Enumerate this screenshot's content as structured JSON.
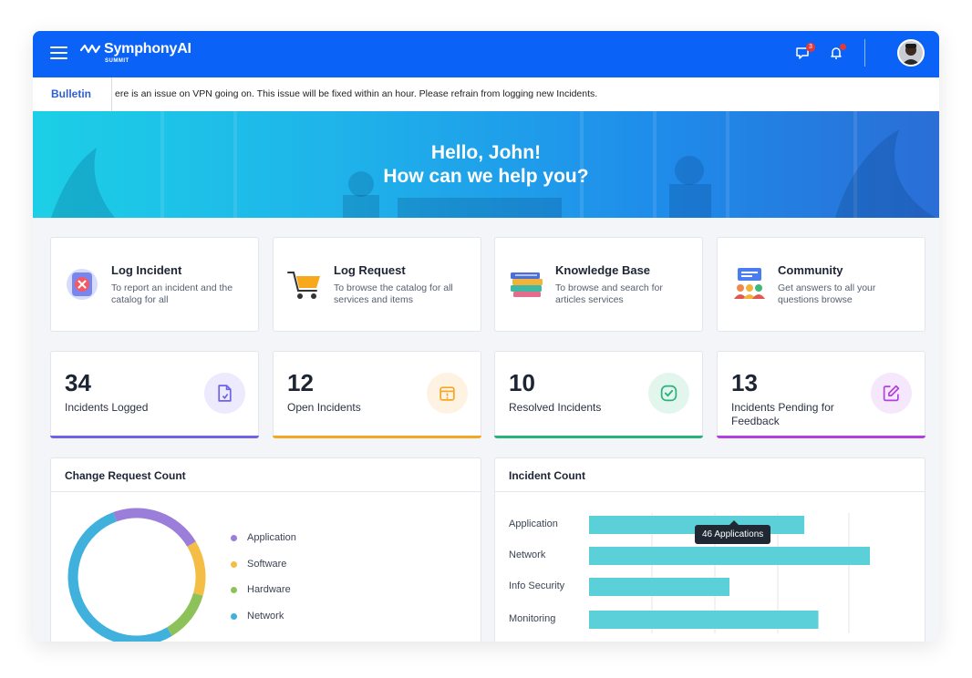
{
  "header": {
    "brand": "SymphonyAI",
    "brand_sub": "SUMMIT",
    "chat_badge": "3",
    "icons": [
      "menu-icon",
      "chat-icon",
      "bell-icon"
    ],
    "accent": "#0a62f7"
  },
  "bulletin": {
    "label": "Bulletin",
    "text": "ere is an issue on VPN going on. This issue will be fixed within an hour. Please refrain from logging new Incidents."
  },
  "hero": {
    "line1": "Hello, John!",
    "line2": "How can we help you?"
  },
  "actions": [
    {
      "title": "Log Incident",
      "desc": "To report an incident and the catalog for all",
      "icon": "incident-icon"
    },
    {
      "title": "Log Request",
      "desc": "To browse the catalog for all services and items",
      "icon": "cart-icon"
    },
    {
      "title": "Knowledge Base",
      "desc": "To browse and search for articles services",
      "icon": "books-icon"
    },
    {
      "title": "Community",
      "desc": "Get answers to all your questions browse",
      "icon": "community-icon"
    }
  ],
  "stats": [
    {
      "value": "34",
      "label": "Incidents Logged",
      "color": "#6c63e6",
      "icon": "document-icon"
    },
    {
      "value": "12",
      "label": "Open Incidents",
      "color": "#f5a623",
      "icon": "open-box-icon"
    },
    {
      "value": "10",
      "label": "Resolved Incidents",
      "color": "#27b37a",
      "icon": "check-icon"
    },
    {
      "value": "13",
      "label": "Incidents Pending for Feedback",
      "color": "#b23fe0",
      "icon": "edit-icon"
    }
  ],
  "change_request": {
    "title": "Change Request Count",
    "legend": [
      {
        "label": "Application",
        "color": "#9b7ed9"
      },
      {
        "label": "Software",
        "color": "#f4bd45"
      },
      {
        "label": "Hardware",
        "color": "#8dc25a"
      },
      {
        "label": "Network",
        "color": "#3fb1dc"
      }
    ]
  },
  "incident_count": {
    "title": "Incident Count",
    "tooltip": "46 Applications",
    "bar_color": "#5bd0d8"
  },
  "chart_data": [
    {
      "type": "pie",
      "title": "Change Request Count",
      "categories": [
        "Application",
        "Software",
        "Hardware",
        "Network"
      ],
      "values": [
        22,
        13,
        12,
        53
      ]
    },
    {
      "type": "bar",
      "title": "Incident Count",
      "orientation": "horizontal",
      "categories": [
        "Application",
        "Network",
        "Info Security",
        "Monitoring"
      ],
      "values": [
        46,
        60,
        30,
        49
      ],
      "xlim": [
        0,
        60
      ],
      "grid": true
    }
  ]
}
